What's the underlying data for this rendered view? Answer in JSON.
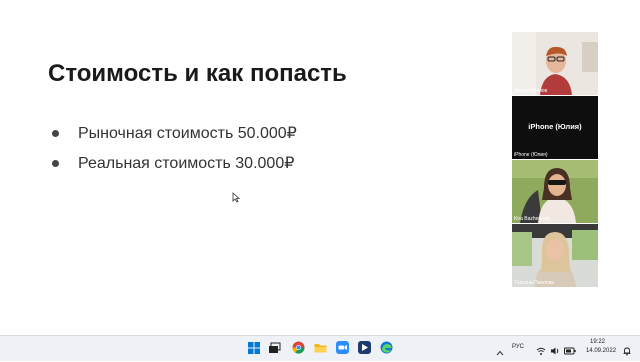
{
  "slide": {
    "title": "Стоимость и как попасть",
    "bullets": [
      "Рыночная стоимость 50.000₽",
      "Реальная стоимость 30.000₽"
    ]
  },
  "participants": [
    {
      "name": "Данил Иванов"
    },
    {
      "name": "iPhone (Юлия)",
      "label": "iPhone (Юлия)"
    },
    {
      "name": "Kira Bazhenova"
    },
    {
      "name": "Татьяна Павлова"
    }
  ],
  "taskbar": {
    "lang": "РУС",
    "time": "19:22",
    "date": "14.09.2022",
    "icons": [
      "windows-icon",
      "search-icon",
      "task-view-icon",
      "chrome-icon",
      "file-explorer-icon",
      "zoom-icon",
      "screen-recorder-icon",
      "security-icon",
      "edge-icon"
    ]
  },
  "colors": {
    "taskbar_bg": "#eef1f5",
    "accent_blue": "#0078d4",
    "zoom_blue": "#2d8cff"
  }
}
